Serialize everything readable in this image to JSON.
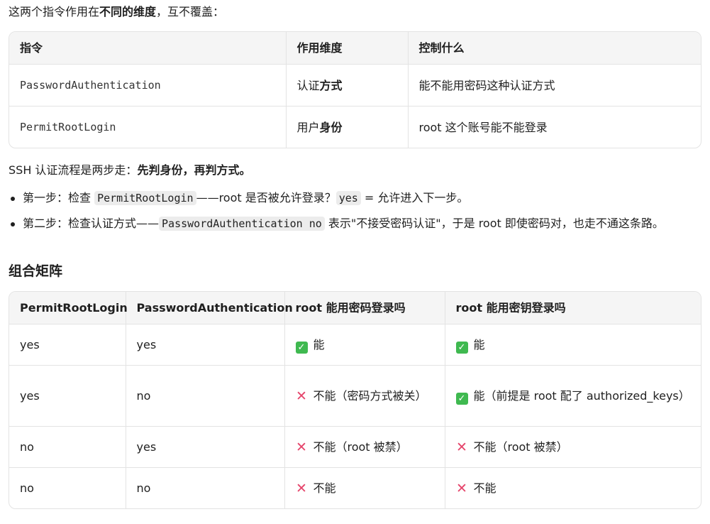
{
  "intro": {
    "prefix": "这两个指令作用在",
    "bold": "不同的维度",
    "suffix": "，互不覆盖："
  },
  "table1": {
    "headers": [
      "指令",
      "作用维度",
      "控制什么"
    ],
    "rows": [
      {
        "directive": "PasswordAuthentication",
        "dim_plain": "认证",
        "dim_bold": "方式",
        "controls": "能不能用密码这种认证方式"
      },
      {
        "directive": "PermitRootLogin",
        "dim_plain": "用户",
        "dim_bold": "身份",
        "controls": "root 这个账号能不能登录"
      }
    ]
  },
  "flow": {
    "prefix": "SSH 认证流程是两步走：",
    "bold": "先判身份，再判方式。"
  },
  "steps": [
    {
      "t1": "第一步：检查 ",
      "c1": "PermitRootLogin",
      "t2": "——root 是否被允许登录？",
      "c2": "yes",
      "t3": " = 允许进入下一步。"
    },
    {
      "t1": "第二步：检查认证方式——",
      "c1": "PasswordAuthentication no",
      "t2": " 表示\"不接受密码认证\"，于是 root 即使密码对，也走不通这条路。"
    }
  ],
  "matrix_heading": "组合矩阵",
  "table2": {
    "headers": [
      "PermitRootLogin",
      "PasswordAuthentication",
      "root 能用密码登录吗",
      "root 能用密钥登录吗"
    ],
    "rows": [
      {
        "prl": "yes",
        "pa": "yes",
        "pwd_icon": "check",
        "pwd": "能",
        "key_icon": "check",
        "key": "能"
      },
      {
        "prl": "yes",
        "pa": "no",
        "pwd_icon": "cross",
        "pwd": "不能（密码方式被关）",
        "key_icon": "check",
        "key": "能（前提是 root 配了 authorized_keys）"
      },
      {
        "prl": "no",
        "pa": "yes",
        "pwd_icon": "cross",
        "pwd": "不能（root 被禁）",
        "key_icon": "cross",
        "key": "不能（root 被禁）"
      },
      {
        "prl": "no",
        "pa": "no",
        "pwd_icon": "cross",
        "pwd": "不能",
        "key_icon": "cross",
        "key": "不能"
      }
    ]
  },
  "colors": {
    "check": "#3fb950",
    "cross": "#e5456b"
  }
}
